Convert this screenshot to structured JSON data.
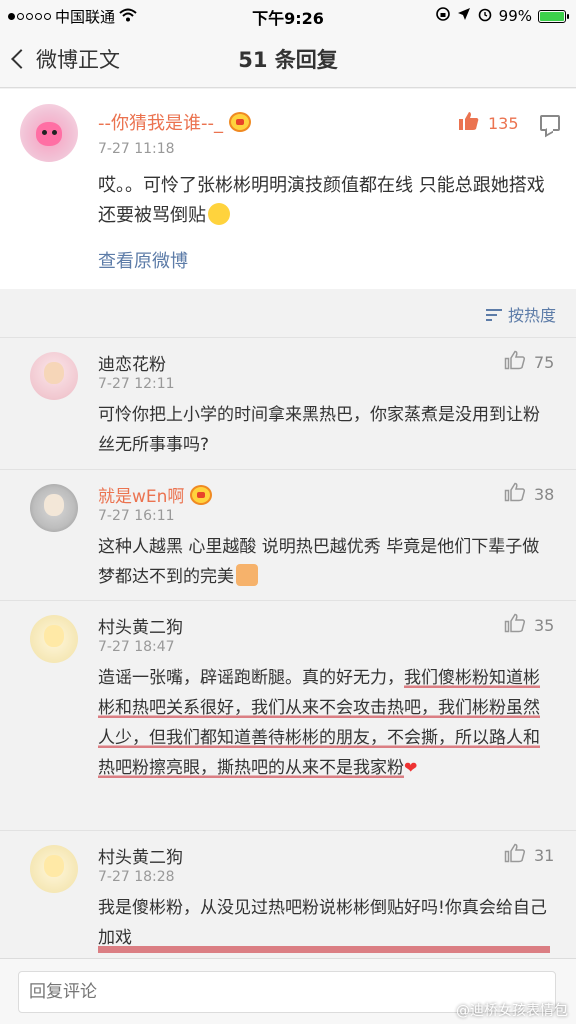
{
  "status_bar": {
    "carrier": "中国联通",
    "time": "下午9:26",
    "battery": "99%"
  },
  "nav": {
    "back_label": "微博正文",
    "title": "51 条回复"
  },
  "original": {
    "name": "--你猜我是谁--_",
    "time": "7-27 11:18",
    "likes": "135",
    "text": "哎。。可怜了张彬彬明明演技颜值都在线 只能总跟她搭戏 还要被骂倒贴",
    "view_original": "查看原微博"
  },
  "sort": {
    "label": "按热度"
  },
  "comments": [
    {
      "name": "迪恋花粉",
      "time": "7-27 12:11",
      "likes": "75",
      "text": "可怜你把上小学的时间拿来黑热巴，你家蒸煮是没用到让粉丝无所事事吗?"
    },
    {
      "name": "就是wEn啊",
      "time": "7-27 16:11",
      "likes": "38",
      "text": "这种人越黑 心里越酸 说明热巴越优秀 毕竟是他们下辈子做梦都达不到的完美"
    },
    {
      "name": "村头黄二狗",
      "time": "7-27 18:47",
      "likes": "35",
      "text_a": "造谣一张嘴，辟谣跑断腿。真的好无力，",
      "text_b": "我们傻彬粉知道彬彬和热吧关系很好，我们从来不会攻击热吧，我们彬粉虽然人少，但我们都知道善待彬彬的朋友，不会撕，所以路人和热吧粉擦亮眼，撕热吧的从来不是我家粉"
    },
    {
      "name": "村头黄二狗",
      "time": "7-27 18:28",
      "likes": "31",
      "text": "我是傻彬粉，从没见过热吧粉说彬彬倒贴好吗!你真会给自己加戏"
    }
  ],
  "reply": {
    "placeholder": "回复评论"
  },
  "watermark": "@迪桥女孩表情包",
  "colors": {
    "accent_orange": "#eb7350",
    "link_blue": "#5d7ca8",
    "heart_red": "#e33333"
  }
}
